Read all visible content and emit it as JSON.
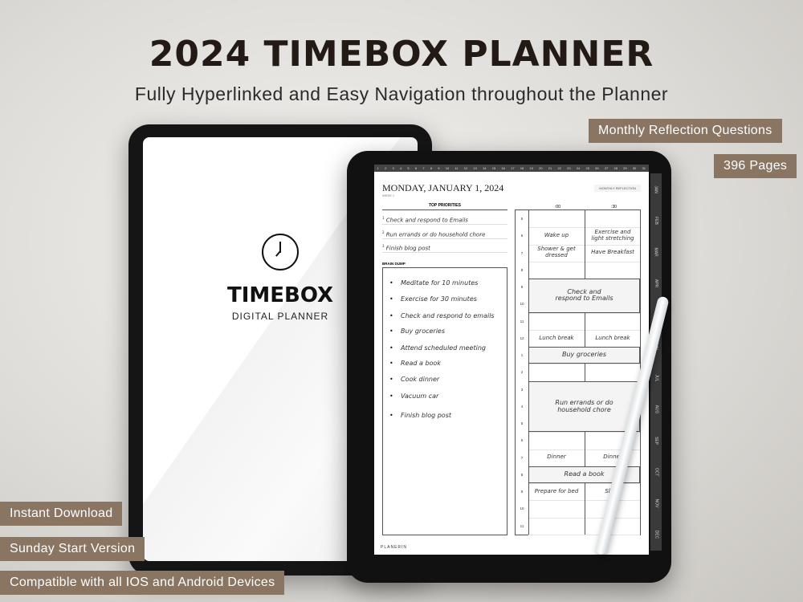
{
  "header": {
    "title": "2024 TIMEBOX PLANNER",
    "subtitle": "Fully Hyperlinked and Easy Navigation throughout the Planner"
  },
  "badges": {
    "monthly": "Monthly Reflection Questions",
    "pages": "396 Pages",
    "instant": "Instant Download",
    "sunday": "Sunday Start Version",
    "compatible": "Compatible with all IOS and Android Devices"
  },
  "badge_color": "#8a7563",
  "cover": {
    "icon": "clock-icon",
    "brand": "TIMEBOX",
    "sub": "DIGITAL PLANNER"
  },
  "planner": {
    "date": "MONDAY, JANUARY 1, 2024",
    "week": "WEEK 1",
    "monthly_reflection": "MONTHLY REFLECTION",
    "day_strip": [
      "1",
      "2",
      "3",
      "4",
      "5",
      "6",
      "7",
      "8",
      "9",
      "10",
      "11",
      "12",
      "13",
      "14",
      "15",
      "16",
      "17",
      "18",
      "19",
      "20",
      "21",
      "22",
      "23",
      "24",
      "25",
      "26",
      "27",
      "28",
      "29",
      "30",
      "31"
    ],
    "months": [
      "JAN",
      "FEB",
      "MAR",
      "APR",
      "MAY",
      "JUN",
      "JUL",
      "AUG",
      "SEP",
      "OCT",
      "NOV",
      "DEC"
    ],
    "top_priorities_label": "TOP PRIORITIES",
    "top_priorities": [
      "Check and respond to Emails",
      "Run errands or do household chore",
      "Finish blog post"
    ],
    "brain_dump_label": "BRAIN DUMP",
    "brain_dump": [
      "Meditate for 10 minutes",
      "Exercise for 30 minutes",
      "Check and respond to emails",
      "Buy groceries",
      "Attend scheduled meeting",
      "Read a book",
      "Cook dinner",
      "Vacuum car",
      "Finish blog post"
    ],
    "col_labels": [
      ":00",
      ":30"
    ],
    "hours": [
      "5",
      "6",
      "7",
      "8",
      "9",
      "10",
      "11",
      "12",
      "1",
      "2",
      "3",
      "4",
      "5",
      "6",
      "7",
      "8",
      "9",
      "10",
      "11"
    ],
    "entries": [
      {
        "row": 1,
        "span": 1,
        "col": "left",
        "text": "Wake up"
      },
      {
        "row": 1,
        "span": 1,
        "col": "right",
        "text": "Exercise and light stretching"
      },
      {
        "row": 2,
        "span": 1,
        "col": "left",
        "text": "Shower & get dressed"
      },
      {
        "row": 2,
        "span": 1,
        "col": "right",
        "text": "Have Breakfast"
      },
      {
        "row": 4,
        "span": 2,
        "col": "both",
        "text": "Check and respond to Emails"
      },
      {
        "row": 7,
        "span": 1,
        "col": "left",
        "text": "Lunch break"
      },
      {
        "row": 7,
        "span": 1,
        "col": "right",
        "text": "Lunch break"
      },
      {
        "row": 8,
        "span": 1,
        "col": "both",
        "text": "Buy groceries"
      },
      {
        "row": 10,
        "span": 3,
        "col": "both",
        "text": "Run errands or do household chore"
      },
      {
        "row": 14,
        "span": 1,
        "col": "left",
        "text": "Dinner"
      },
      {
        "row": 14,
        "span": 1,
        "col": "right",
        "text": "Dinner"
      },
      {
        "row": 15,
        "span": 1,
        "col": "both",
        "text": "Read a book"
      },
      {
        "row": 16,
        "span": 1,
        "col": "left",
        "text": "Prepare for bed"
      },
      {
        "row": 16,
        "span": 1,
        "col": "right",
        "text": "Sleep"
      }
    ],
    "footer": "PLANERIN"
  }
}
